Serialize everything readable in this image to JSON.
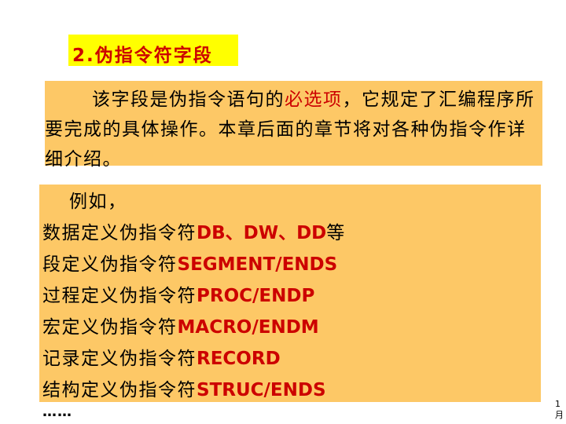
{
  "title": "2.伪指令符字段",
  "intro": {
    "before": "该字段是伪指令语句的",
    "highlight": "必选项",
    "after": "，它规定了汇编程序所要完成的具体操作。本章后面的章节将对各种伪指令作详细介绍。"
  },
  "examples": {
    "lead": "例如，",
    "items": [
      {
        "desc": "数据定义伪指令符",
        "code": "DB、DW、DD",
        "suffix": "等"
      },
      {
        "desc": "段定义伪指令符",
        "code": "SEGMENT/ENDS",
        "suffix": ""
      },
      {
        "desc": "过程定义伪指令符",
        "code": "PROC/ENDP",
        "suffix": ""
      },
      {
        "desc": "宏定义伪指令符",
        "code": "MACRO/ENDM",
        "suffix": ""
      },
      {
        "desc": "记录定义伪指令符",
        "code": "RECORD",
        "suffix": ""
      },
      {
        "desc": "结构定义伪指令符",
        "code": "STRUC/ENDS",
        "suffix": ""
      }
    ],
    "ellipsis": "……"
  },
  "page_mark": "1\n月",
  "colors": {
    "title_bg": "#ffff00",
    "box_bg": "#fdc866",
    "accent_red": "#cc0000"
  }
}
